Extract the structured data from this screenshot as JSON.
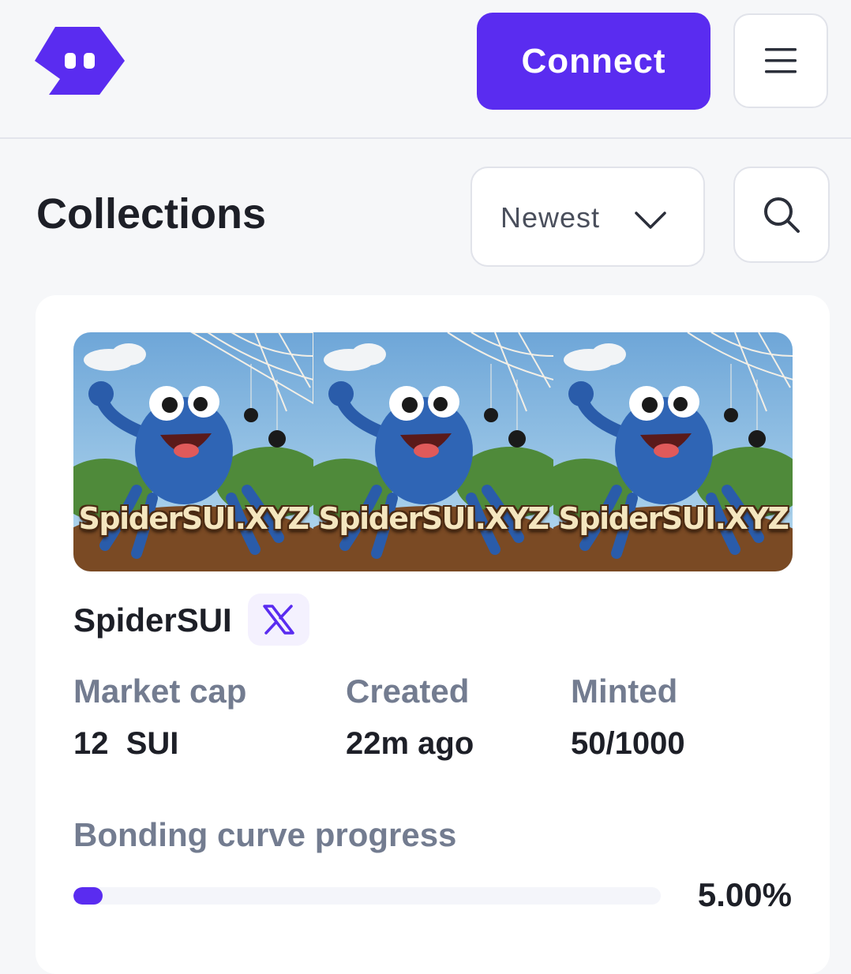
{
  "header": {
    "logo_icon": "brand-logo-icon",
    "connect_label": "Connect",
    "menu_icon": "hamburger-menu-icon"
  },
  "page": {
    "title": "Collections"
  },
  "sort": {
    "selected": "Newest",
    "icon": "chevron-down-icon"
  },
  "search": {
    "icon": "search-icon"
  },
  "collection": {
    "banner_text": "SpiderSUI.XYZ",
    "name": "SpiderSUI",
    "social_icon": "x-twitter-icon",
    "stats": [
      {
        "label": "Market cap",
        "value": "12  SUI"
      },
      {
        "label": "Created",
        "value": "22m ago"
      },
      {
        "label": "Minted",
        "value": "50/1000"
      }
    ],
    "progress": {
      "label": "Bonding curve progress",
      "percent_text": "5.00%",
      "fraction": 0.05
    }
  },
  "colors": {
    "accent": "#5a2cf0",
    "muted_text": "#737c90",
    "border": "#e1e3ea"
  }
}
